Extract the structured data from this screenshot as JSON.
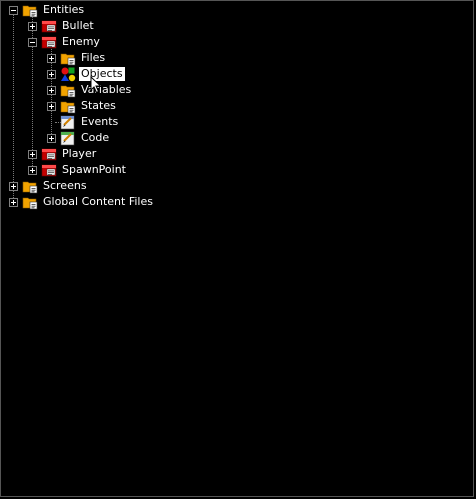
{
  "tree": {
    "entities": "Entities",
    "bullet": "Bullet",
    "enemy": "Enemy",
    "files": "Files",
    "objects": "Objects",
    "variables": "Variables",
    "states": "States",
    "events": "Events",
    "code": "Code",
    "player": "Player",
    "spawnpoint": "SpawnPoint",
    "screens": "Screens",
    "global_content": "Global Content Files"
  },
  "icons": {
    "folder": "folder-icon",
    "entity": "entity-icon",
    "objects": "objects-icon",
    "events": "events-icon",
    "code": "code-icon"
  },
  "colors": {
    "background": "#000000",
    "text": "#ffffff",
    "selection_bg": "#ffffff",
    "selection_text": "#000000",
    "folder": "#f2a300",
    "entity_red": "#c40000"
  }
}
